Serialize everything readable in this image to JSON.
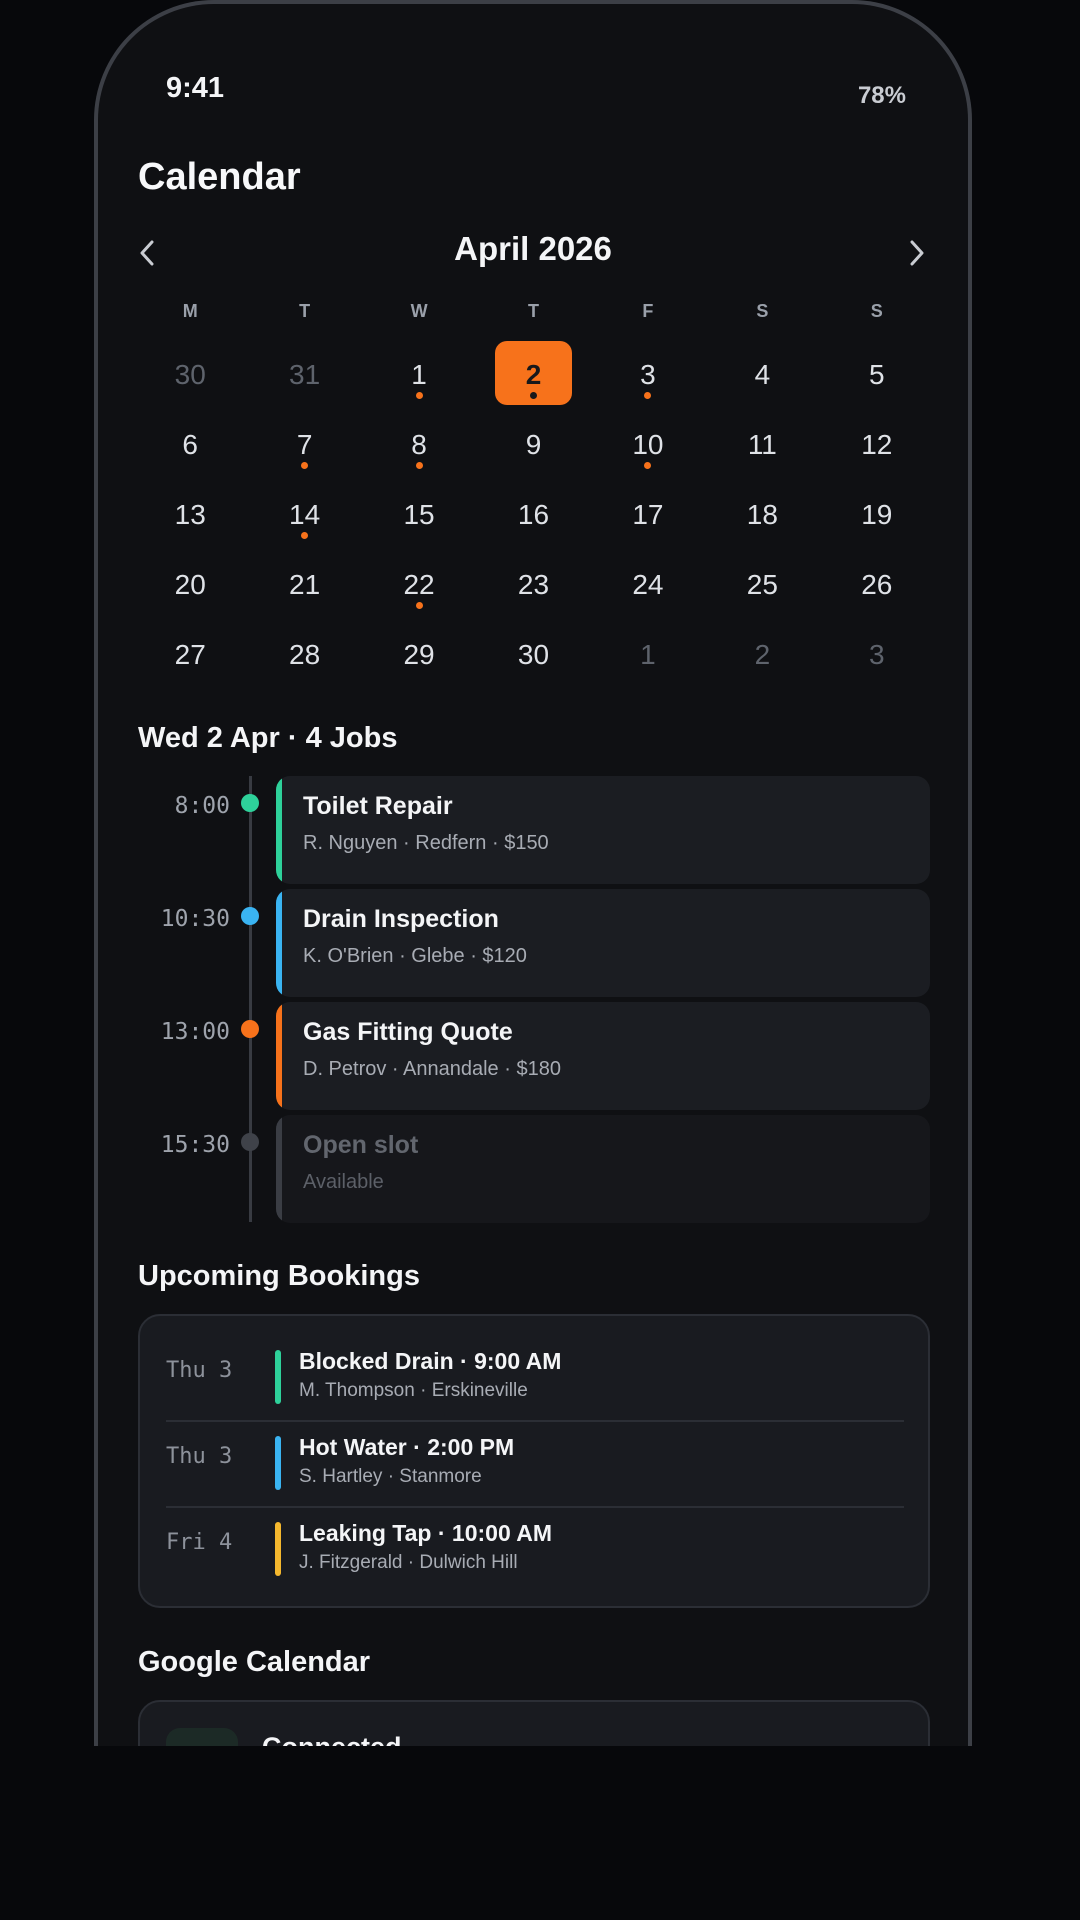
{
  "status_bar": {
    "time": "9:41",
    "battery": "78%"
  },
  "page_title": "Calendar",
  "calendar": {
    "month_label": "April 2026",
    "weekdays": [
      "M",
      "T",
      "W",
      "T",
      "F",
      "S",
      "S"
    ],
    "days": [
      {
        "n": "30",
        "muted": true
      },
      {
        "n": "31",
        "muted": true
      },
      {
        "n": "1",
        "dot": true
      },
      {
        "n": "2",
        "dot": true,
        "selected": true
      },
      {
        "n": "3",
        "dot": true
      },
      {
        "n": "4"
      },
      {
        "n": "5"
      },
      {
        "n": "6"
      },
      {
        "n": "7",
        "dot": true
      },
      {
        "n": "8",
        "dot": true
      },
      {
        "n": "9"
      },
      {
        "n": "10",
        "dot": true
      },
      {
        "n": "11"
      },
      {
        "n": "12"
      },
      {
        "n": "13"
      },
      {
        "n": "14",
        "dot": true
      },
      {
        "n": "15"
      },
      {
        "n": "16"
      },
      {
        "n": "17"
      },
      {
        "n": "18"
      },
      {
        "n": "19"
      },
      {
        "n": "20"
      },
      {
        "n": "21"
      },
      {
        "n": "22",
        "dot": true
      },
      {
        "n": "23"
      },
      {
        "n": "24"
      },
      {
        "n": "25"
      },
      {
        "n": "26"
      },
      {
        "n": "27"
      },
      {
        "n": "28"
      },
      {
        "n": "29"
      },
      {
        "n": "30"
      },
      {
        "n": "1",
        "muted": true
      },
      {
        "n": "2",
        "muted": true
      },
      {
        "n": "3",
        "muted": true
      }
    ]
  },
  "day_schedule": {
    "heading": "Wed 2 Apr · 4 Jobs",
    "jobs": [
      {
        "time": "8:00",
        "title": "Toilet Repair",
        "sub": "R. Nguyen · Redfern · $150",
        "color": "#2ed19a"
      },
      {
        "time": "10:30",
        "title": "Drain Inspection",
        "sub": "K. O'Brien · Glebe · $120",
        "color": "#3ab4f2"
      },
      {
        "time": "13:00",
        "title": "Gas Fitting Quote",
        "sub": "D. Petrov · Annandale · $180",
        "color": "#f7721b"
      },
      {
        "time": "15:30",
        "title": "Open slot",
        "sub": "Available",
        "color": "#3a3d44"
      }
    ]
  },
  "upcoming": {
    "heading": "Upcoming Bookings",
    "bookings": [
      {
        "date": "Thu 3",
        "title": "Blocked Drain · 9:00 AM",
        "sub": "M. Thompson · Erskineville",
        "color": "#2ed19a"
      },
      {
        "date": "Thu 3",
        "title": "Hot Water · 2:00 PM",
        "sub": "S. Hartley · Stanmore",
        "color": "#3ab4f2"
      },
      {
        "date": "Fri 4",
        "title": "Leaking Tap · 10:00 AM",
        "sub": "J. Fitzgerald · Dulwich Hill",
        "color": "#f5b82e"
      }
    ]
  },
  "google": {
    "heading": "Google Calendar",
    "status": "Connected"
  },
  "colors": {
    "accent": "#f7721b",
    "background": "#0f1013",
    "card": "#1b1d22"
  }
}
